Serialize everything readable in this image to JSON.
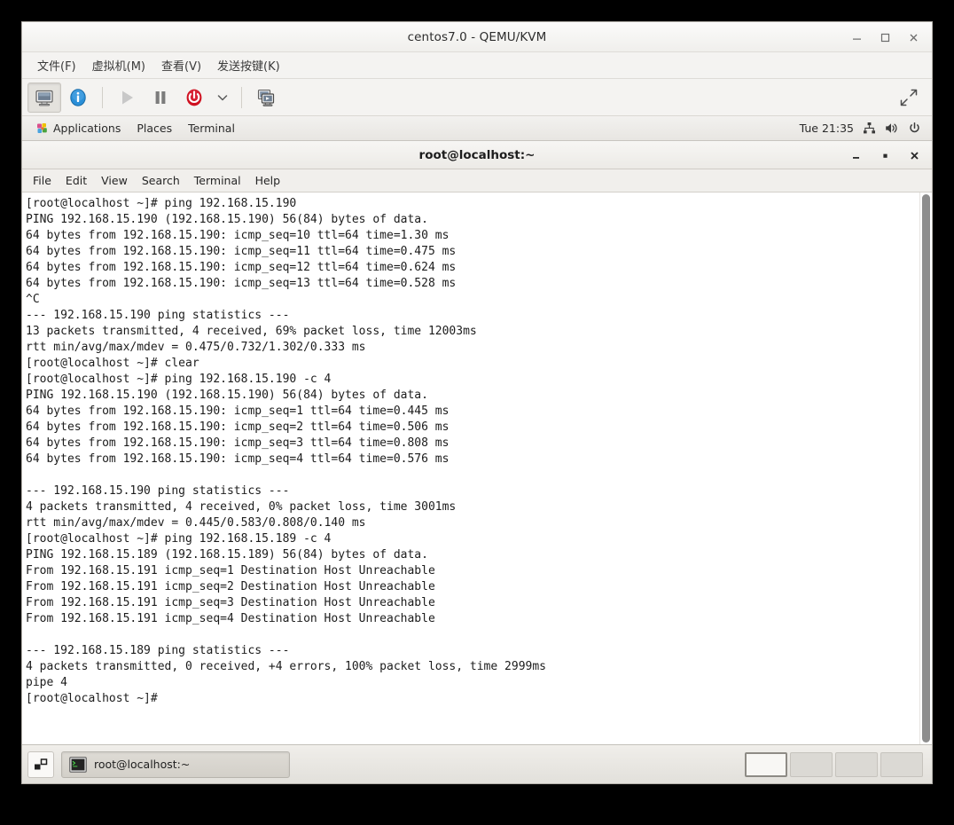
{
  "vm_window": {
    "title": "centos7.0 - QEMU/KVM",
    "controls": {
      "minimize": "minimize",
      "maximize": "maximize",
      "close": "close"
    },
    "menubar": [
      {
        "label": "文件(F)",
        "name": "file"
      },
      {
        "label": "虚拟机(M)",
        "name": "virtual-machine"
      },
      {
        "label": "查看(V)",
        "name": "view"
      },
      {
        "label": "发送按键(K)",
        "name": "send-key"
      }
    ],
    "toolbar": [
      {
        "name": "show-console-button",
        "icon": "monitor-icon",
        "pressed": true,
        "enabled": true
      },
      {
        "name": "show-details-button",
        "icon": "info-icon",
        "pressed": false,
        "enabled": true
      },
      {
        "name": "run-button",
        "icon": "play-icon",
        "pressed": false,
        "enabled": false
      },
      {
        "name": "pause-button",
        "icon": "pause-icon",
        "pressed": false,
        "enabled": true
      },
      {
        "name": "shutdown-button",
        "icon": "power-icon",
        "pressed": false,
        "enabled": true
      },
      {
        "name": "shutdown-menu-button",
        "icon": "chevron-down-icon",
        "pressed": false,
        "enabled": true
      },
      {
        "name": "snapshots-button",
        "icon": "snapshot-icon",
        "pressed": false,
        "enabled": true
      }
    ],
    "fullscreen_button": {
      "name": "fullscreen-button",
      "icon": "fullscreen-icon"
    }
  },
  "guest": {
    "top_panel": {
      "menus": [
        {
          "label": "Applications",
          "icon": "gnome-foot-icon"
        },
        {
          "label": "Places",
          "icon": ""
        },
        {
          "label": "Terminal",
          "icon": ""
        }
      ],
      "clock": "Tue 21:35",
      "tray": [
        {
          "name": "network-icon",
          "icon": "network-icon"
        },
        {
          "name": "volume-icon",
          "icon": "volume-icon"
        },
        {
          "name": "power-icon",
          "icon": "power-icon"
        }
      ]
    },
    "terminal": {
      "title": "root@localhost:~",
      "controls": {
        "minimize": "minimize",
        "maximize": "maximize",
        "close": "close"
      },
      "menubar": [
        {
          "label": "File",
          "name": "file"
        },
        {
          "label": "Edit",
          "name": "edit"
        },
        {
          "label": "View",
          "name": "view"
        },
        {
          "label": "Search",
          "name": "search"
        },
        {
          "label": "Terminal",
          "name": "terminal"
        },
        {
          "label": "Help",
          "name": "help"
        }
      ],
      "lines": [
        "[root@localhost ~]# ping 192.168.15.190",
        "PING 192.168.15.190 (192.168.15.190) 56(84) bytes of data.",
        "64 bytes from 192.168.15.190: icmp_seq=10 ttl=64 time=1.30 ms",
        "64 bytes from 192.168.15.190: icmp_seq=11 ttl=64 time=0.475 ms",
        "64 bytes from 192.168.15.190: icmp_seq=12 ttl=64 time=0.624 ms",
        "64 bytes from 192.168.15.190: icmp_seq=13 ttl=64 time=0.528 ms",
        "^C",
        "--- 192.168.15.190 ping statistics ---",
        "13 packets transmitted, 4 received, 69% packet loss, time 12003ms",
        "rtt min/avg/max/mdev = 0.475/0.732/1.302/0.333 ms",
        "[root@localhost ~]# clear",
        "[root@localhost ~]# ping 192.168.15.190 -c 4",
        "PING 192.168.15.190 (192.168.15.190) 56(84) bytes of data.",
        "64 bytes from 192.168.15.190: icmp_seq=1 ttl=64 time=0.445 ms",
        "64 bytes from 192.168.15.190: icmp_seq=2 ttl=64 time=0.506 ms",
        "64 bytes from 192.168.15.190: icmp_seq=3 ttl=64 time=0.808 ms",
        "64 bytes from 192.168.15.190: icmp_seq=4 ttl=64 time=0.576 ms",
        "",
        "--- 192.168.15.190 ping statistics ---",
        "4 packets transmitted, 4 received, 0% packet loss, time 3001ms",
        "rtt min/avg/max/mdev = 0.445/0.583/0.808/0.140 ms",
        "[root@localhost ~]# ping 192.168.15.189 -c 4",
        "PING 192.168.15.189 (192.168.15.189) 56(84) bytes of data.",
        "From 192.168.15.191 icmp_seq=1 Destination Host Unreachable",
        "From 192.168.15.191 icmp_seq=2 Destination Host Unreachable",
        "From 192.168.15.191 icmp_seq=3 Destination Host Unreachable",
        "From 192.168.15.191 icmp_seq=4 Destination Host Unreachable",
        "",
        "--- 192.168.15.189 ping statistics ---",
        "4 packets transmitted, 0 received, +4 errors, 100% packet loss, time 2999ms",
        "pipe 4",
        "[root@localhost ~]#"
      ]
    },
    "taskbar": {
      "show_desktop": "show-desktop",
      "windows": [
        {
          "label": "root@localhost:~",
          "icon": "terminal-icon",
          "active": true
        }
      ],
      "workspaces": [
        {
          "name": "workspace-1",
          "active": true
        },
        {
          "name": "workspace-2",
          "active": false
        },
        {
          "name": "workspace-3",
          "active": false
        },
        {
          "name": "workspace-4",
          "active": false
        }
      ]
    }
  },
  "colors": {
    "accent_blue": "#2a8fd8",
    "power_red": "#cf1020",
    "terminal_bg": "#ffffff",
    "terminal_fg": "#1c1c1c",
    "chrome_bg": "#f4f3f1"
  }
}
